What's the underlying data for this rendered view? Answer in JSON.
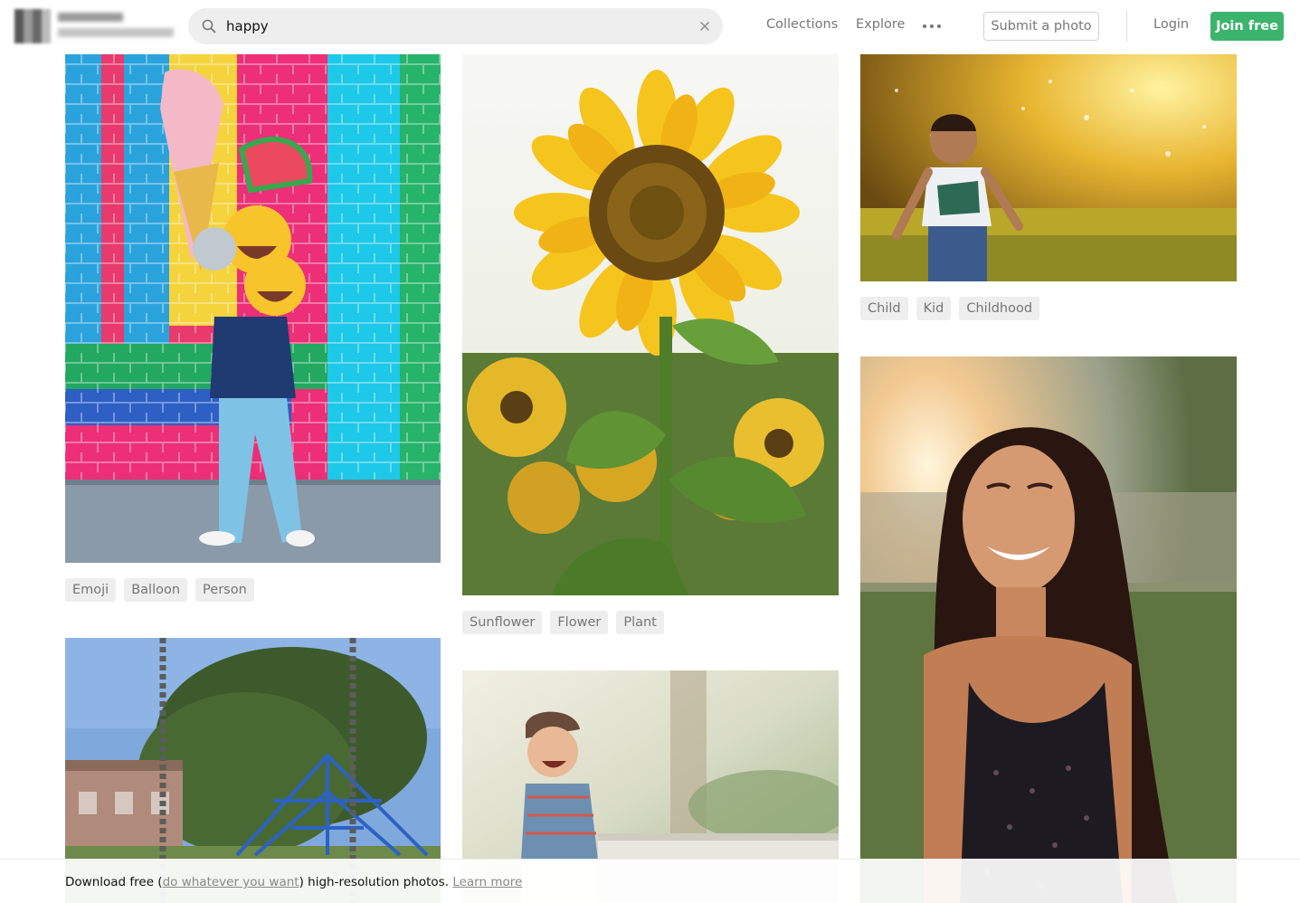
{
  "header": {
    "search": {
      "value": "happy"
    },
    "nav": {
      "collections": "Collections",
      "explore": "Explore"
    },
    "submit_label": "Submit a photo",
    "login_label": "Login",
    "join_label": "Join free",
    "icons": {
      "search": "search-icon",
      "clear": "close-icon",
      "more": "more-horizontal-icon"
    },
    "colors": {
      "join": "#3cb46e",
      "search_bg": "#eeeeee"
    }
  },
  "photos": [
    {
      "tags": [
        "Emoji",
        "Balloon",
        "Person"
      ]
    },
    {
      "tags": [
        "Sunflower",
        "Flower",
        "Plant"
      ]
    },
    {
      "tags": [
        "Child",
        "Kid",
        "Childhood"
      ]
    },
    {
      "tags": []
    },
    {
      "tags": []
    },
    {
      "tags": []
    }
  ],
  "banner": {
    "prefix": "Download free (",
    "link1": "do whatever you want",
    "middle": ") high-resolution photos. ",
    "link2": "Learn more"
  }
}
